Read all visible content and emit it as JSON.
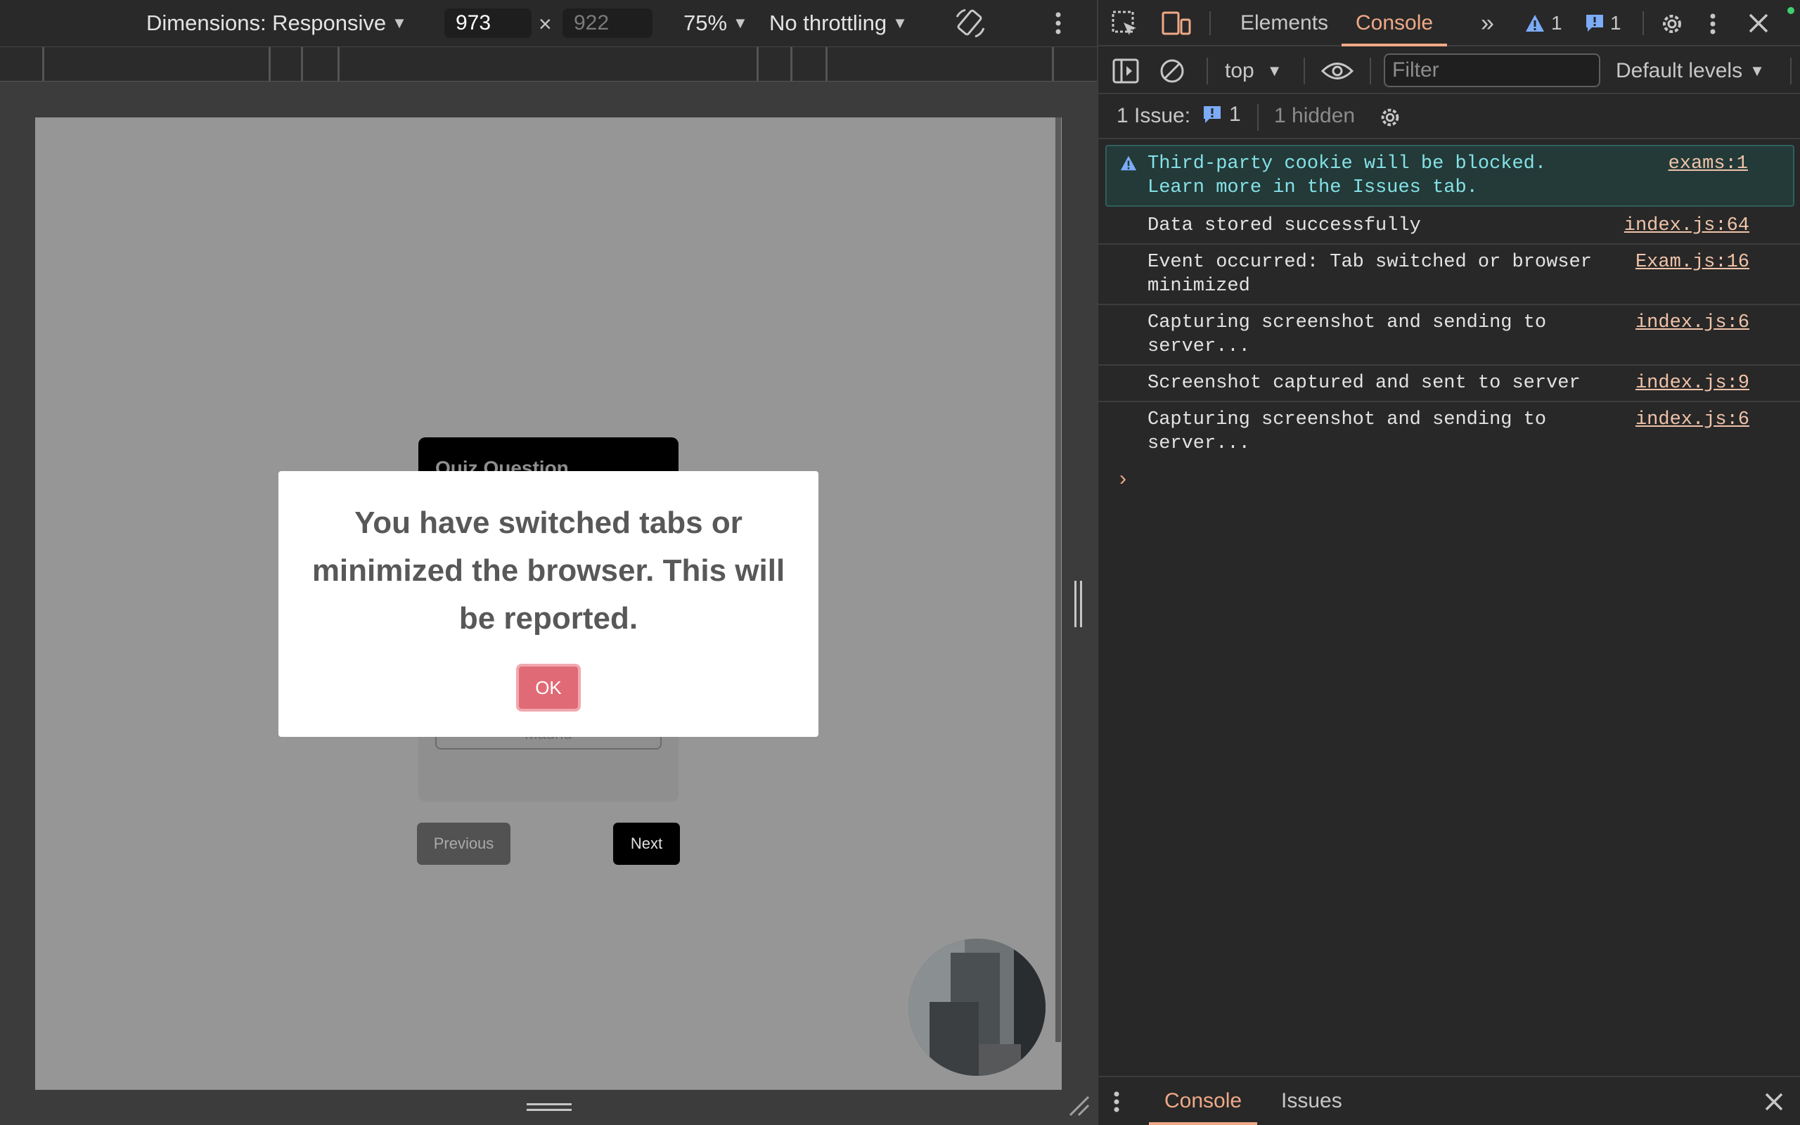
{
  "device_toolbar": {
    "dimensions_label": "Dimensions: Responsive",
    "width_value": "973",
    "times": "×",
    "height_value": "922",
    "zoom": "75%",
    "throttling": "No throttling",
    "icons": [
      "chevron-down-icon",
      "rotate-icon",
      "more-vertical-icon"
    ]
  },
  "page": {
    "quiz_title": "Quiz Question",
    "option_text": "Madrid",
    "previous_label": "Previous",
    "next_label": "Next",
    "modal_message": "You have switched tabs or minimized the browser. This will be reported.",
    "ok_label": "OK"
  },
  "devtools": {
    "tabs": [
      "Elements",
      "Console"
    ],
    "active_tab": "Console",
    "warning_count": "1",
    "issue_count": "1",
    "console_toolbar": {
      "context": "top",
      "filter_placeholder": "Filter",
      "levels": "Default levels"
    },
    "issues_bar": {
      "label": "1 Issue:",
      "count": "1",
      "hidden": "1 hidden"
    },
    "messages": [
      {
        "text": "Third-party cookie will be blocked. Learn more in the Issues tab.",
        "source": "exams:1",
        "level": "warning"
      },
      {
        "text": "Data stored successfully",
        "source": "index.js:64"
      },
      {
        "text": "Event occurred: Tab switched or browser minimized",
        "source": "Exam.js:16"
      },
      {
        "text": "Capturing screenshot and sending to server...",
        "source": "index.js:6"
      },
      {
        "text": "Screenshot captured and sent to server",
        "source": "index.js:9"
      },
      {
        "text": "Capturing screenshot and sending to server...",
        "source": "index.js:6"
      }
    ],
    "prompt": "›",
    "drawer_tabs": [
      "Console",
      "Issues"
    ],
    "colors": {
      "accent": "#f0a987",
      "warning_bg": "#233a38",
      "link": "#f0c3a9",
      "modal_ok": "#e06a76"
    }
  }
}
